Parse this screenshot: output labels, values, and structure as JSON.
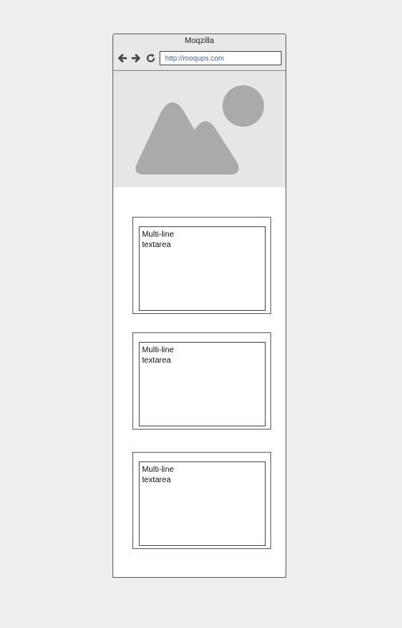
{
  "window": {
    "title": "Moqzilla",
    "url": "http://moqups.com"
  },
  "nav": {
    "back_icon": "arrow-left-icon",
    "forward_icon": "arrow-right-icon",
    "reload_icon": "reload-icon"
  },
  "hero": {
    "icon": "image-placeholder-icon"
  },
  "textareas": [
    {
      "text": "Multi-line\ntextarea"
    },
    {
      "text": "Multi-line\ntextarea"
    },
    {
      "text": "Multi-line\ntextarea"
    }
  ],
  "colors": {
    "page_bg": "#eeeeee",
    "chrome_bg": "#e8e8e8",
    "placeholder_shape": "#aaaaaa",
    "url_text": "#3366aa"
  }
}
